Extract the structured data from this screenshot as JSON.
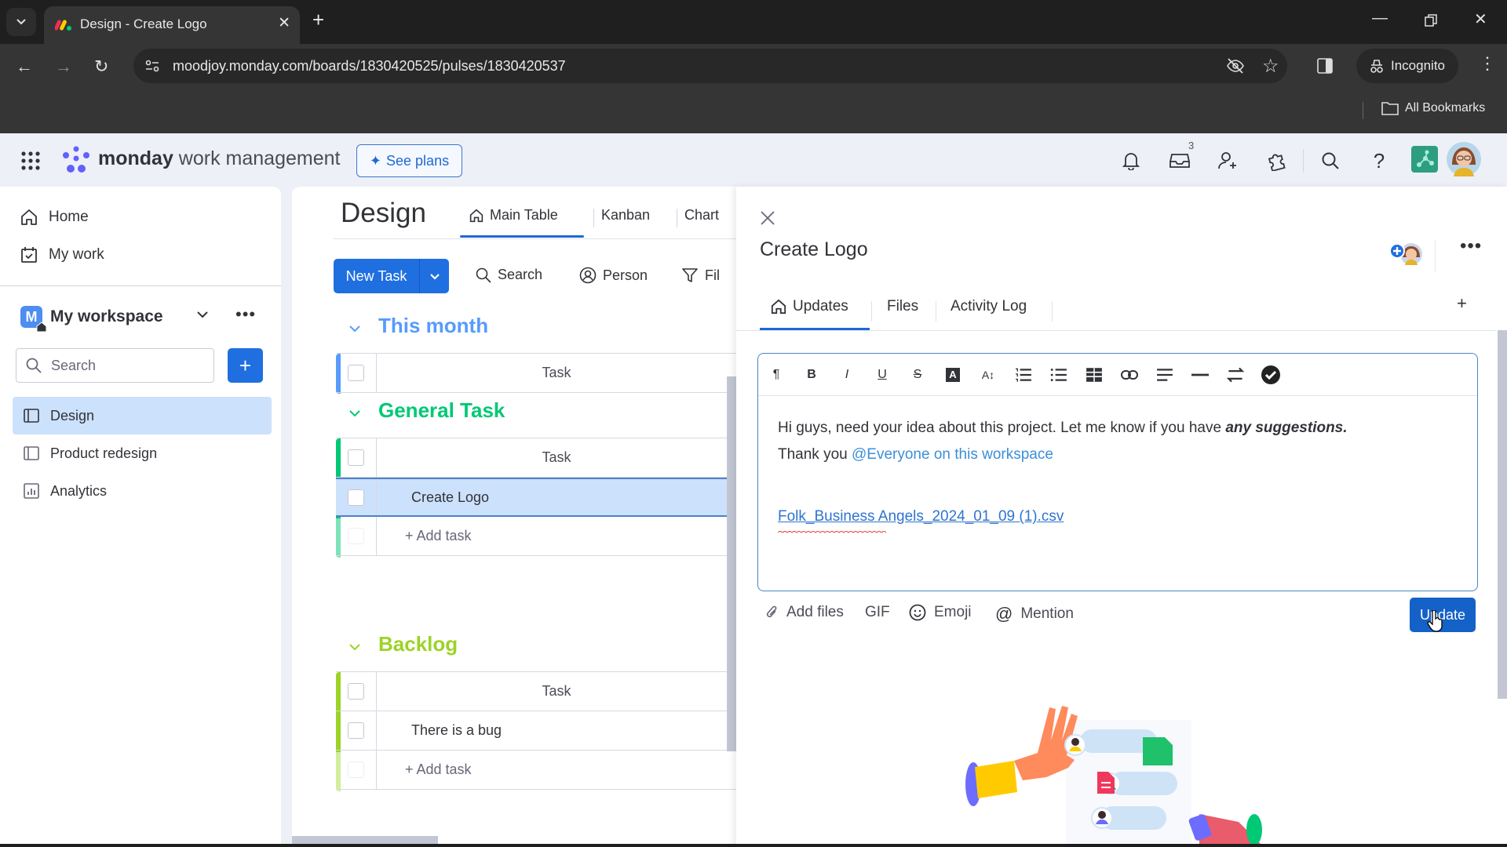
{
  "browser": {
    "tab_title": "Design - Create Logo",
    "url": "moodjoy.monday.com/boards/1830420525/pulses/1830420537",
    "incognito_label": "Incognito",
    "bookmarks_label": "All Bookmarks"
  },
  "topnav": {
    "brand_bold": "monday",
    "brand_rest": " work management",
    "see_plans": "See plans",
    "inbox_badge": "3"
  },
  "sidebar": {
    "home": "Home",
    "my_work": "My work",
    "workspace_initial": "M",
    "workspace_name": "My workspace",
    "search_placeholder": "Search",
    "boards": [
      {
        "label": "Design",
        "active": true,
        "icon": "board-icon"
      },
      {
        "label": "Product redesign",
        "active": false,
        "icon": "board-icon"
      },
      {
        "label": "Analytics",
        "active": false,
        "icon": "dashboard-icon"
      }
    ]
  },
  "board": {
    "title": "Design",
    "views": [
      "Main Table",
      "Kanban",
      "Chart"
    ],
    "new_task": "New Task",
    "tools": {
      "search": "Search",
      "person": "Person",
      "filter": "Fil"
    },
    "groups": [
      {
        "title": "This month",
        "color": "#579bfc",
        "header": "Task",
        "items": [],
        "add": null
      },
      {
        "title": "General Task",
        "color": "#00c875",
        "header": "Task",
        "items": [
          "Create Logo"
        ],
        "add": "+ Add task"
      },
      {
        "title": "Backlog",
        "color": "#9cd326",
        "header": "Task",
        "items": [
          "There is a bug"
        ],
        "add": "+ Add task"
      }
    ]
  },
  "panel": {
    "title": "Create Logo",
    "tabs": [
      "Updates",
      "Files",
      "Activity Log"
    ],
    "editor": {
      "line1": "Hi guys, need your idea about this project. Let me know if you have ",
      "line1_bold": "any suggestions.",
      "line2": "Thank you ",
      "mention": "@Everyone on this workspace",
      "attachment": "Folk_Business Angels_2024_01_09 (1).csv"
    },
    "actions": {
      "add_files": "Add files",
      "gif": "GIF",
      "emoji": "Emoji",
      "mention": "Mention",
      "update": "Update"
    }
  },
  "colors": {
    "primary": "#1f6fe0",
    "selected_row": "#cce1fb",
    "mention": "#3b8fd9"
  }
}
